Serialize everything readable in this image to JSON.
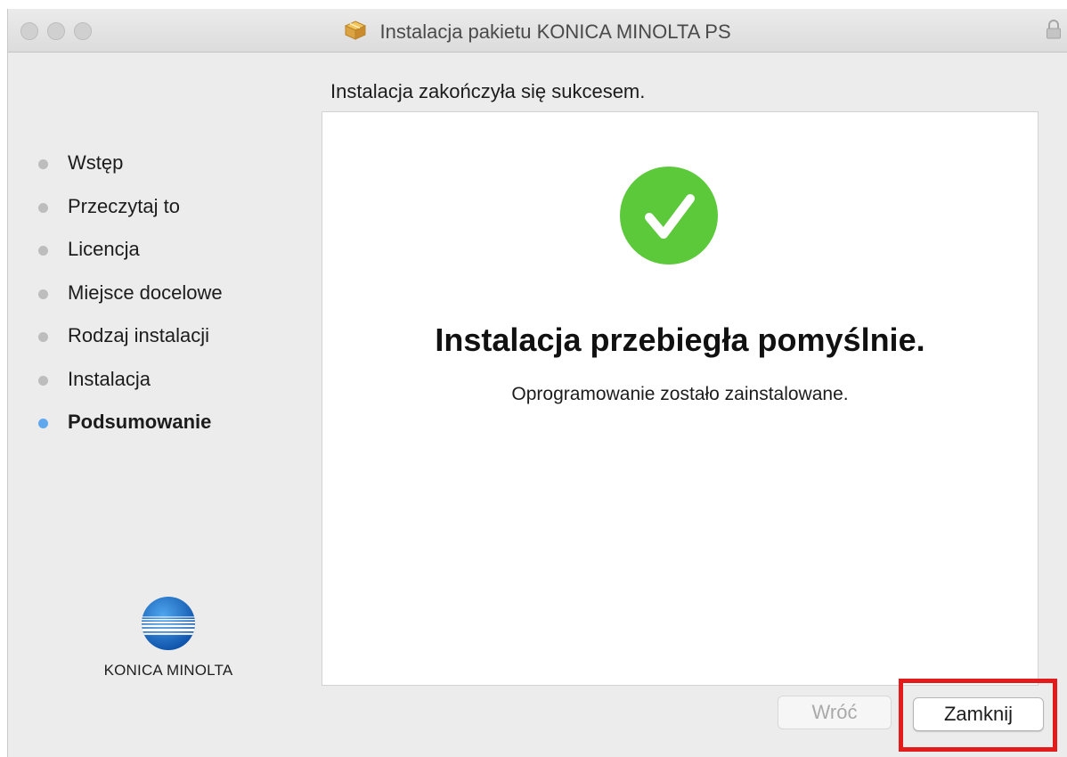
{
  "window": {
    "title": "Instalacja pakietu KONICA MINOLTA PS"
  },
  "sidebar": {
    "steps": [
      {
        "label": "Wstęp",
        "state": "done"
      },
      {
        "label": "Przeczytaj to",
        "state": "done"
      },
      {
        "label": "Licencja",
        "state": "done"
      },
      {
        "label": "Miejsce docelowe",
        "state": "done"
      },
      {
        "label": "Rodzaj instalacji",
        "state": "done"
      },
      {
        "label": "Instalacja",
        "state": "done"
      },
      {
        "label": "Podsumowanie",
        "state": "current"
      }
    ],
    "logo_text": "KONICA MINOLTA"
  },
  "main": {
    "header": "Instalacja zakończyła się sukcesem.",
    "success_title": "Instalacja przebiegła pomyślnie.",
    "success_subtitle": "Oprogramowanie zostało zainstalowane."
  },
  "buttons": {
    "back_label": "Wróć",
    "back_enabled": false,
    "close_label": "Zamknij"
  },
  "colors": {
    "success_green": "#5cc93b",
    "current_step_blue": "#5fa8f0",
    "highlight_red": "#e31b1b"
  },
  "icons": {
    "titlebar": "package-icon",
    "lock": "lock-icon",
    "success": "checkmark-circle-icon",
    "brand": "konica-minolta-globe-icon"
  }
}
